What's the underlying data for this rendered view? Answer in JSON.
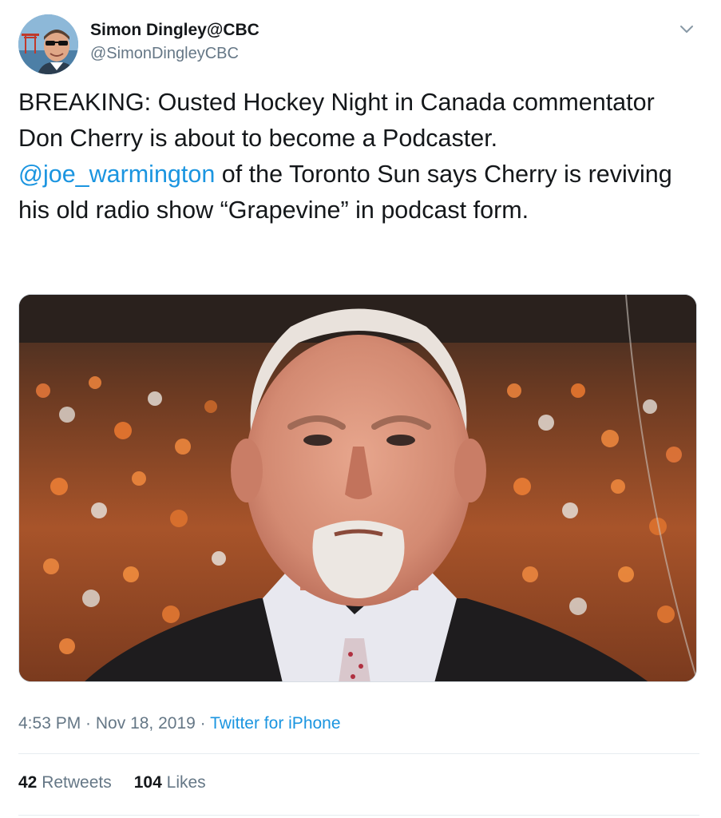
{
  "author": {
    "name": "Simon Dingley@CBC",
    "handle": "@SimonDingleyCBC",
    "avatar_icon": "profile-photo"
  },
  "menu": {
    "icon": "chevron-down-icon"
  },
  "tweet": {
    "text_before": "BREAKING: Ousted Hockey Night in Canada commentator Don Cherry is about to become a Podcaster.  ",
    "mention": "@joe_warmington",
    "text_after": " of the Toronto Sun says Cherry is reviving his old radio show “Grapevine” in podcast form."
  },
  "media": {
    "description_icon": "photo"
  },
  "meta": {
    "time": "4:53 PM",
    "sep1": " · ",
    "date": "Nov 18, 2019",
    "sep2": " · ",
    "source": "Twitter for iPhone"
  },
  "stats": {
    "retweets_count": "42",
    "retweets_label": "Retweets",
    "likes_count": "104",
    "likes_label": "Likes"
  },
  "colors": {
    "link": "#1b95e0",
    "secondary_text": "#657786",
    "primary_text": "#14171a",
    "divider": "#e6ecf0"
  }
}
